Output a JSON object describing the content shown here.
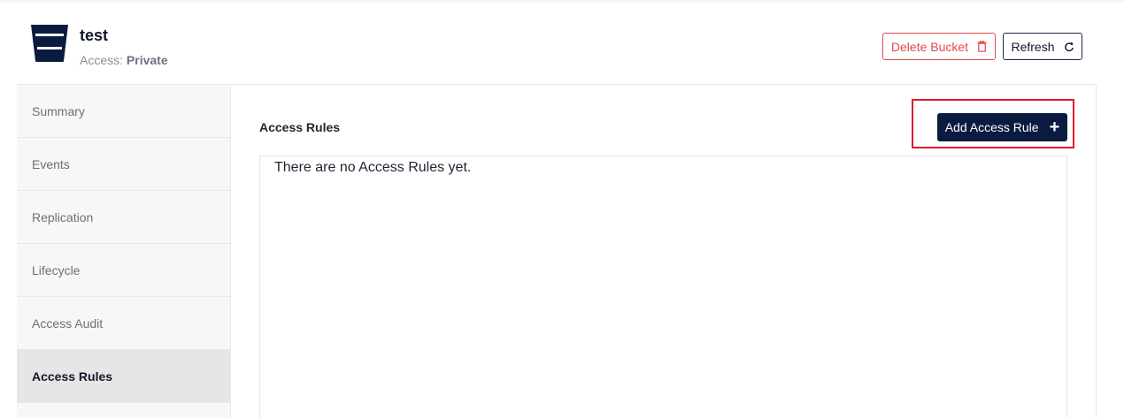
{
  "bucket": {
    "name": "test",
    "access_label": "Access:",
    "access_value": "Private"
  },
  "actions": {
    "delete_label": "Delete Bucket",
    "refresh_label": "Refresh"
  },
  "sidebar": {
    "items": [
      {
        "label": "Summary",
        "active": false
      },
      {
        "label": "Events",
        "active": false
      },
      {
        "label": "Replication",
        "active": false
      },
      {
        "label": "Lifecycle",
        "active": false
      },
      {
        "label": "Access Audit",
        "active": false
      },
      {
        "label": "Access Rules",
        "active": true
      }
    ]
  },
  "main": {
    "section_title": "Access Rules",
    "add_button_label": "Add Access Rule",
    "empty_message": "There are no Access Rules yet."
  },
  "icons": {
    "bucket": "bucket-icon",
    "delete": "trash-icon",
    "refresh": "refresh-icon",
    "add": "plus-icon"
  },
  "colors": {
    "brand_navy": "#0b1b3f",
    "danger": "#e54848",
    "highlight": "#e11d2a"
  }
}
